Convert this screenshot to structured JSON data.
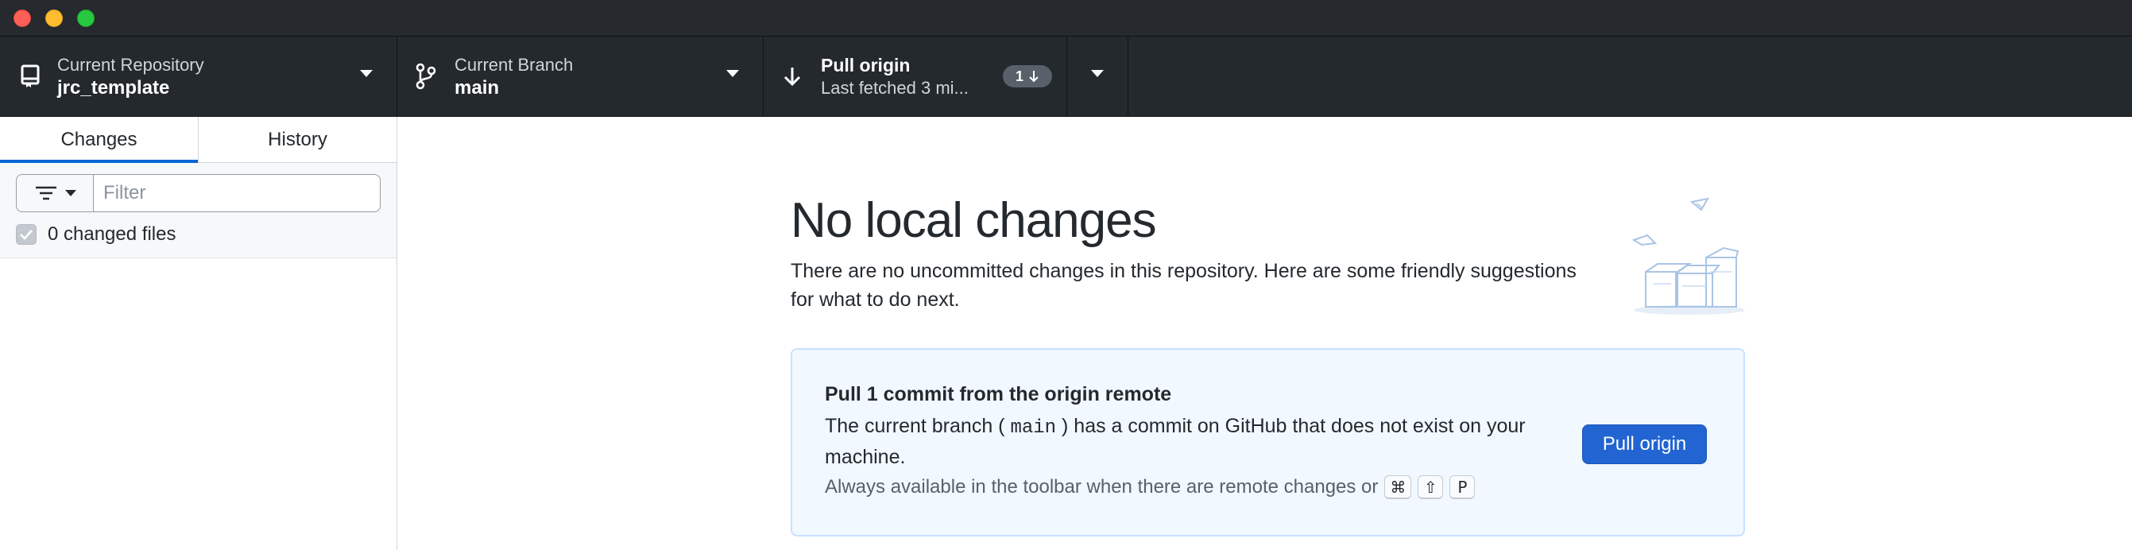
{
  "window": {
    "traffic_lights": [
      "close",
      "minimize",
      "maximize"
    ]
  },
  "toolbar": {
    "repository": {
      "label": "Current Repository",
      "value": "jrc_template",
      "icon": "repo-icon"
    },
    "branch": {
      "label": "Current Branch",
      "value": "main",
      "icon": "git-branch-icon"
    },
    "pull": {
      "label": "Pull origin",
      "value": "Last fetched 3 mi...",
      "icon": "arrow-down-icon",
      "badge_count": "1"
    }
  },
  "sidebar": {
    "tabs": [
      {
        "label": "Changes",
        "active": true
      },
      {
        "label": "History",
        "active": false
      }
    ],
    "filter": {
      "placeholder": "Filter",
      "value": ""
    },
    "changed_files_label": "0 changed files"
  },
  "main": {
    "title": "No local changes",
    "description": "There are no uncommitted changes in this repository. Here are some friendly suggestions for what to do next.",
    "suggestion": {
      "title": "Pull 1 commit from the origin remote",
      "desc_before": "The current branch (",
      "branch_code": "main",
      "desc_after": ") has a commit on GitHub that does not exist on your machine.",
      "hint": "Always available in the toolbar when there are remote changes or",
      "shortcut_keys": [
        "⌘",
        "⇧",
        "P"
      ],
      "button_label": "Pull origin"
    }
  },
  "colors": {
    "toolbar_bg": "#24292e",
    "accent": "#0366d6",
    "primary_button": "#2264d1",
    "suggestion_bg": "#f1f8ff"
  }
}
